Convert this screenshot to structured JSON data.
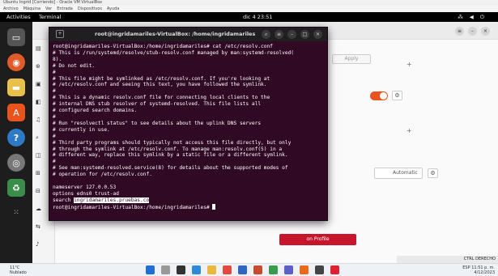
{
  "vbox": {
    "title": "Ubuntu Ingrid [Corriendo] - Oracle VM VirtualBox",
    "menu": [
      "Archivo",
      "Máquina",
      "Ver",
      "Entrada",
      "Dispositivos",
      "Ayuda"
    ]
  },
  "topbar": {
    "activities": "Activities",
    "app": "Terminal",
    "clock": "dic 4  23:51",
    "sys_icons": "⁂ ◀ ⏻"
  },
  "terminal": {
    "title": "root@ingridamariles-VirtualBox: /home/ingridamariles",
    "lines": [
      "root@ingridamariles-VirtualBox:/home/ingridamariles# cat /etc/resolv.conf",
      "# This is /run/systemd/resolve/stub-resolv.conf managed by man:systemd-resolved(",
      "8).",
      "# Do not edit.",
      "#",
      "# This file might be symlinked as /etc/resolv.conf. If you're looking at",
      "# /etc/resolv.conf and seeing this text, you have followed the symlink.",
      "#",
      "# This is a dynamic resolv.conf file for connecting local clients to the",
      "# internal DNS stub resolver of systemd-resolved. This file lists all",
      "# configured search domains.",
      "#",
      "# Run \"resolvectl status\" to see details about the uplink DNS servers",
      "# currently in use.",
      "#",
      "# Third party programs should typically not access this file directly, but only",
      "# through the symlink at /etc/resolv.conf. To manage man:resolv.conf(5) in a",
      "# different way, replace this symlink by a static file or a different symlink.",
      "#",
      "# See man:systemd-resolved.service(8) for details about the supported modes of",
      "# operation for /etc/resolv.conf.",
      "",
      "nameserver 127.0.0.53",
      "options edns0 trust-ad"
    ],
    "search_prefix": "search ",
    "search_domain": "ingridamariles.pruebas.co",
    "prompt": "root@ingridamariles-VirtualBox:/home/ingridamariles# "
  },
  "settings": {
    "apply_label": "Apply",
    "automatic_label": "Automatic",
    "profile_button": "on Profile"
  },
  "taskbar": {
    "weather_temp": "11°C",
    "weather_desc": "Nublado",
    "tray_lang": "ESP",
    "tray_time": "11:51 p. m.",
    "tray_date": "4/12/2023",
    "vbox_status": "CTRL DERECHO"
  },
  "colors": {
    "terminal_bg": "#300a24",
    "ubuntu_orange": "#e95420",
    "profile_red": "#c7162b"
  }
}
